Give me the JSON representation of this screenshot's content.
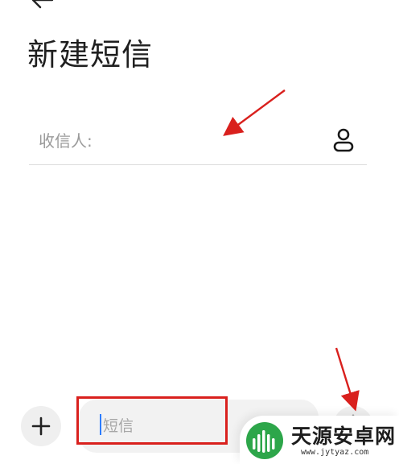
{
  "header": {
    "title": "新建短信",
    "back_icon": "back-arrow-icon"
  },
  "recipient": {
    "placeholder": "收信人:",
    "contact_icon": "contact-person-icon"
  },
  "composer": {
    "add_icon": "plus-icon",
    "message_placeholder": "短信",
    "send_icon": "send-arrow-icon"
  },
  "annotations": {
    "color": "#d9201d"
  },
  "watermark": {
    "title": "天源安卓网",
    "url": "www.jytyaz.com",
    "logo_color": "#2da64a"
  }
}
